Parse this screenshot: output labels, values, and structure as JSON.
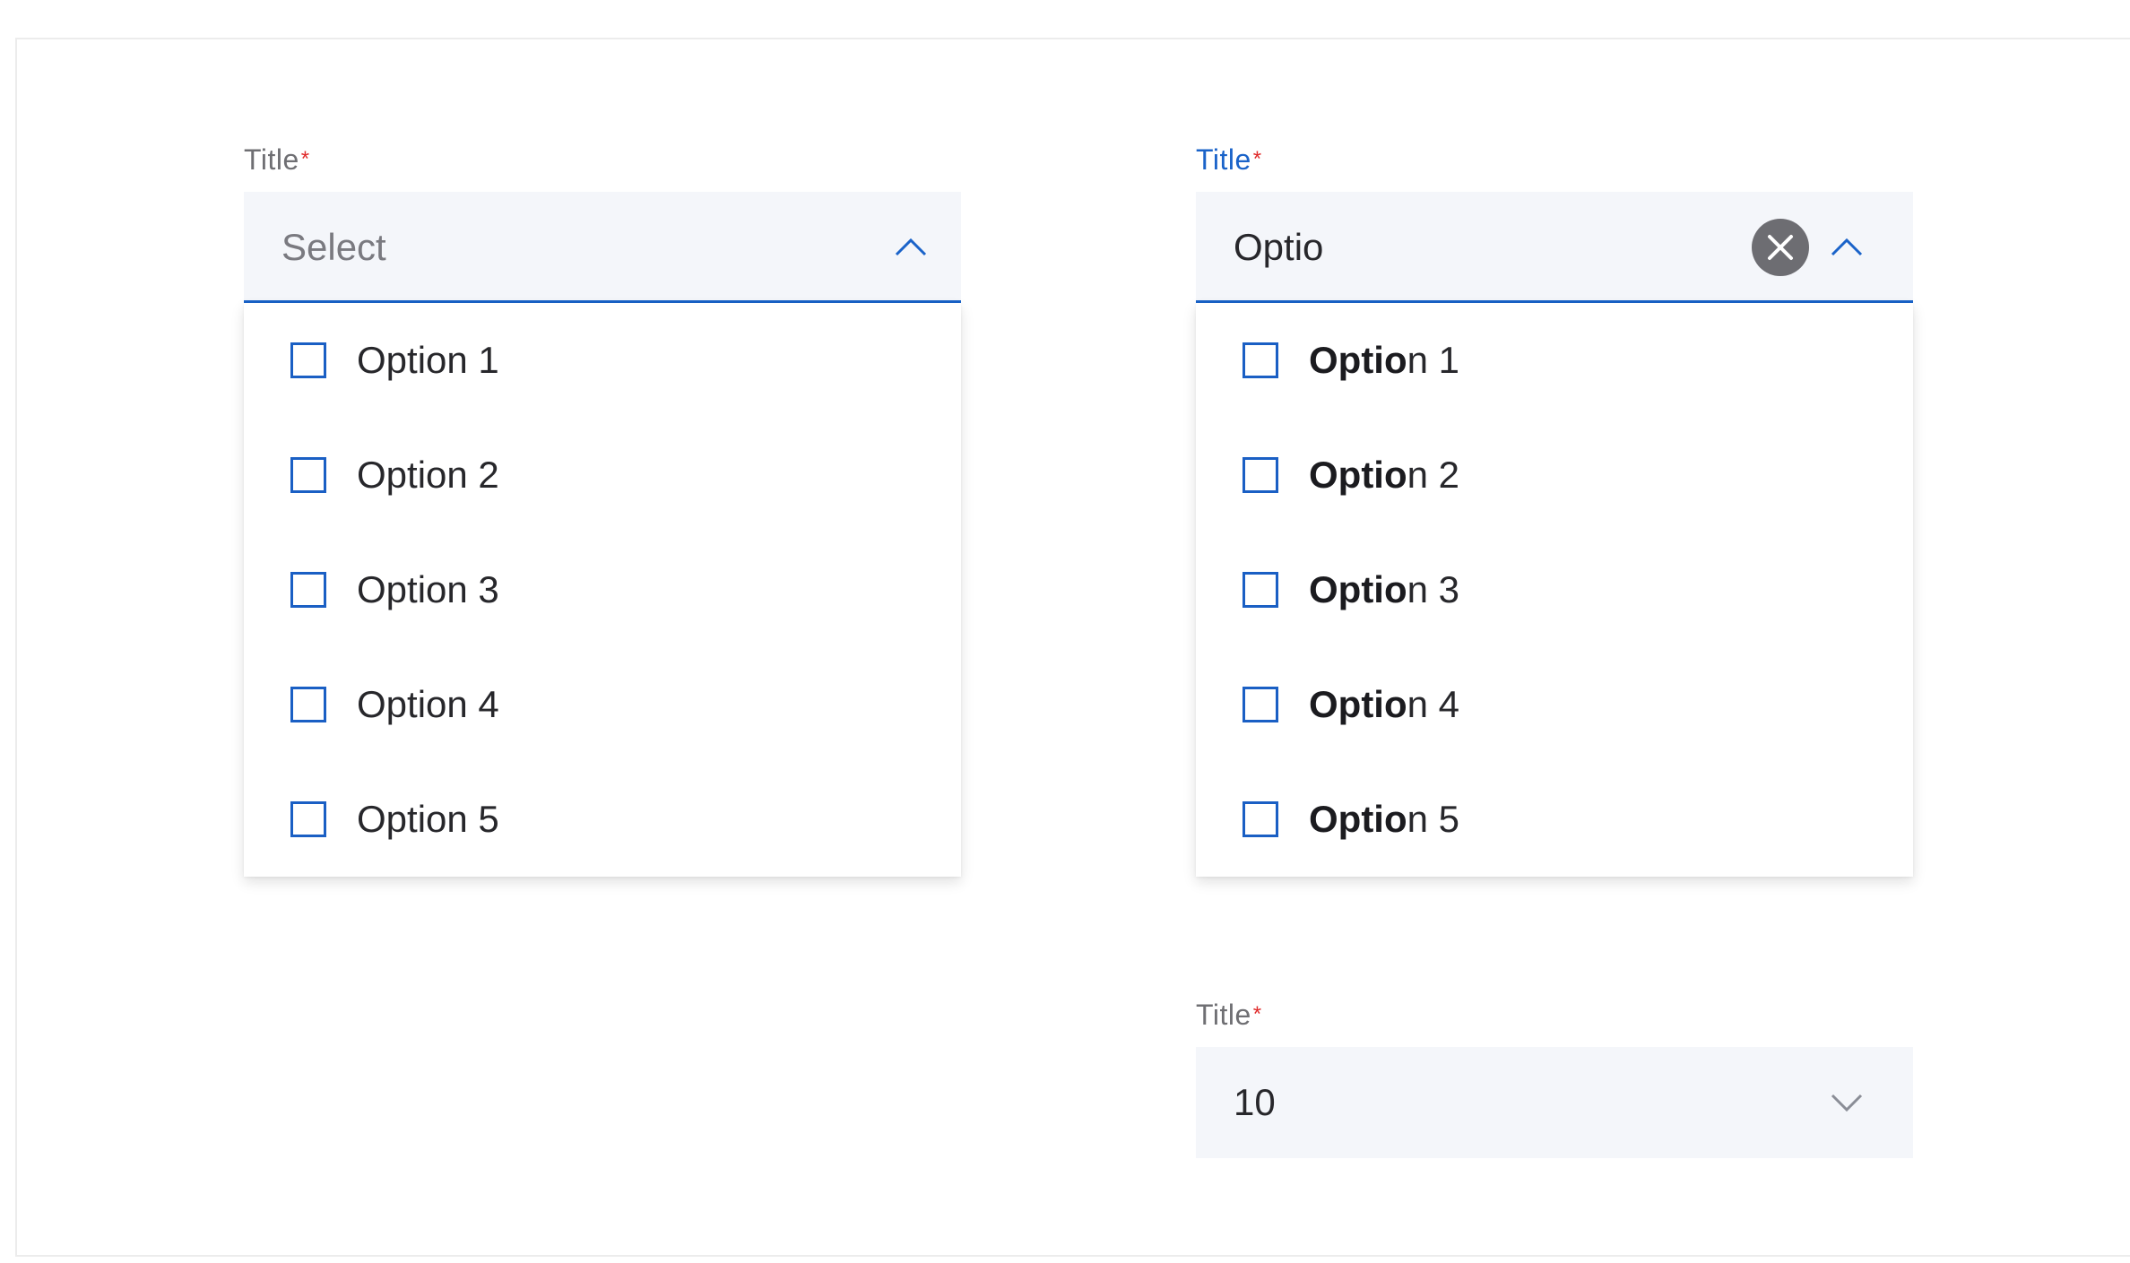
{
  "multi_select_empty": {
    "label": "Title",
    "required_mark": "*",
    "placeholder": "Select",
    "options": [
      {
        "label": "Option 1"
      },
      {
        "label": "Option 2"
      },
      {
        "label": "Option 3"
      },
      {
        "label": "Option 4"
      },
      {
        "label": "Option 5"
      }
    ]
  },
  "multi_select_search": {
    "label": "Title",
    "required_mark": "*",
    "search_value": "Optio",
    "options": [
      {
        "match": "Optio",
        "rest": "n 1"
      },
      {
        "match": "Optio",
        "rest": "n 2"
      },
      {
        "match": "Optio",
        "rest": "n 3"
      },
      {
        "match": "Optio",
        "rest": "n 4"
      },
      {
        "match": "Optio",
        "rest": "n 5"
      }
    ]
  },
  "single_select_closed": {
    "label": "Title",
    "required_mark": "*",
    "value": "10"
  },
  "icons": {
    "open_chevron": "chevron-up-icon",
    "closed_chevron": "chevron-down-icon",
    "clear": "clear-circle-icon"
  },
  "colors": {
    "accent": "#1a63c9",
    "required": "#e02a2a",
    "field_background": "#f4f6fa",
    "text": "#27272b",
    "muted_text": "#6f6f73",
    "clear_button": "#6d6d72"
  }
}
